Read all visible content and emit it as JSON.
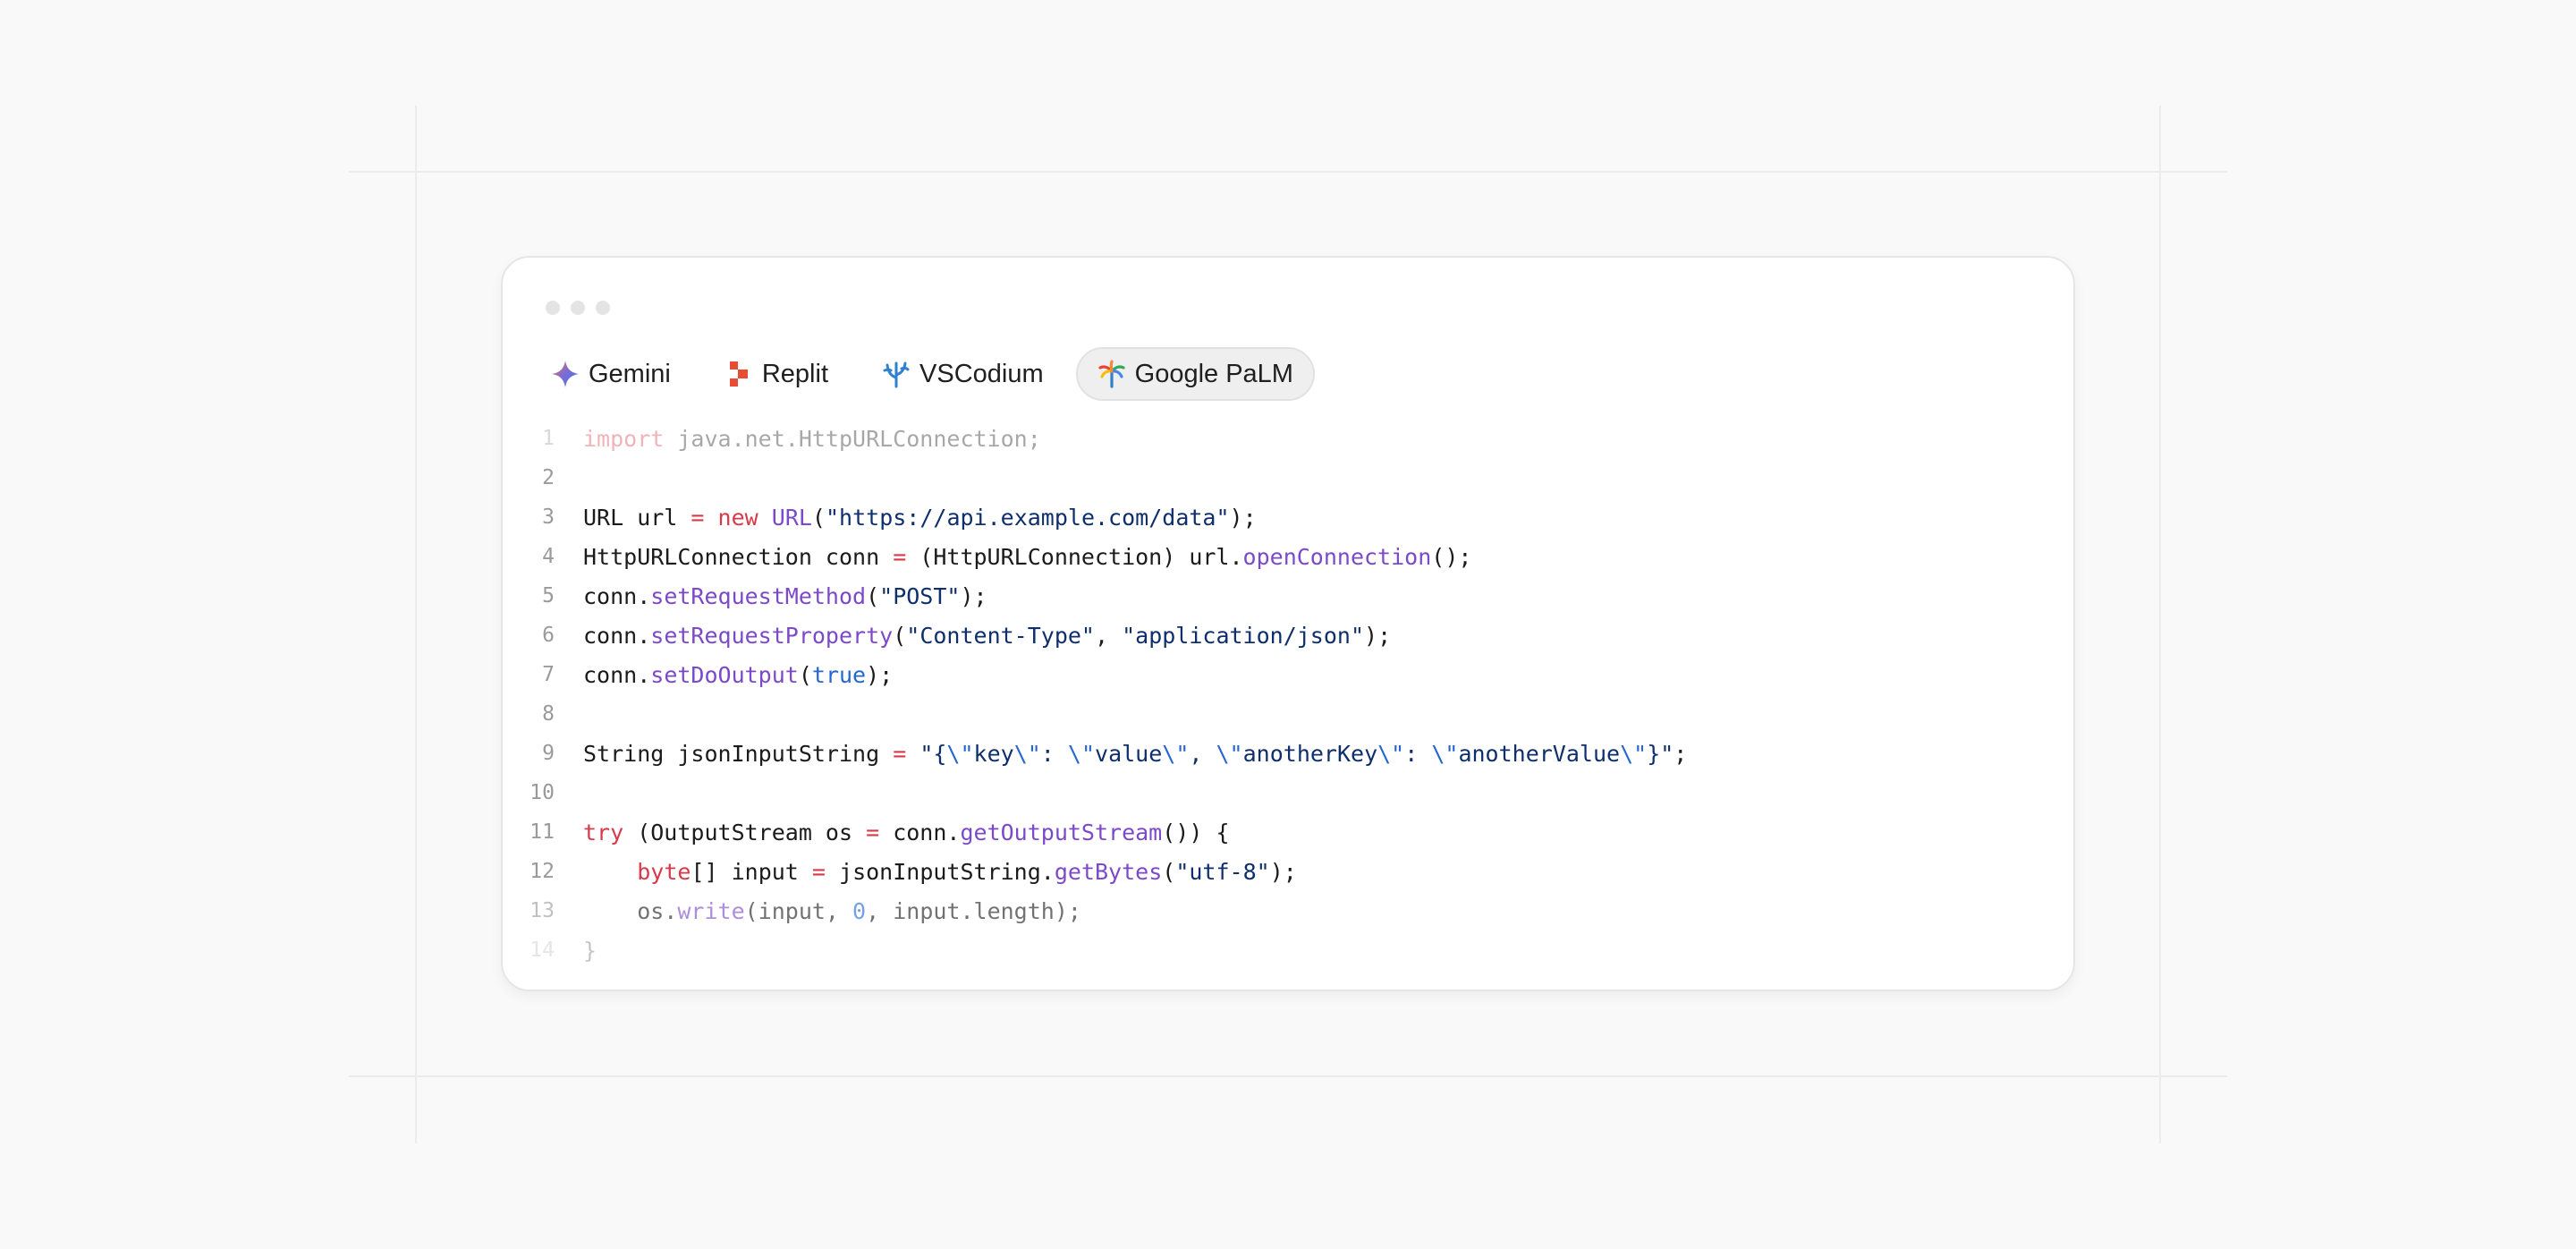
{
  "window": {
    "controls": [
      "close",
      "minimize",
      "maximize"
    ]
  },
  "tabs": [
    {
      "label": "Gemini",
      "icon": "gemini-icon",
      "active": false
    },
    {
      "label": "Replit",
      "icon": "replit-icon",
      "active": false
    },
    {
      "label": "VSCodium",
      "icon": "vscodium-icon",
      "active": false
    },
    {
      "label": "Google PaLM",
      "icon": "google-palm-icon",
      "active": true
    }
  ],
  "code": {
    "language": "java",
    "line_numbers": [
      "1",
      "2",
      "3",
      "4",
      "5",
      "6",
      "7",
      "8",
      "9",
      "10",
      "11",
      "12",
      "13",
      "14"
    ],
    "lines": [
      "import java.net.HttpURLConnection;",
      "",
      "URL url = new URL(\"https://api.example.com/data\");",
      "HttpURLConnection conn = (HttpURLConnection) url.openConnection();",
      "conn.setRequestMethod(\"POST\");",
      "conn.setRequestProperty(\"Content-Type\", \"application/json\");",
      "conn.setDoOutput(true);",
      "",
      "String jsonInputString = \"{\\\"key\\\": \\\"value\\\", \\\"anotherKey\\\": \\\"anotherValue\\\"}\";",
      "",
      "try (OutputStream os = conn.getOutputStream()) {",
      "    byte[] input = jsonInputString.getBytes(\"utf-8\");",
      "    os.write(input, 0, input.length);",
      "}"
    ]
  },
  "colors": {
    "keyword": "#d73a49",
    "function": "#7b49c9",
    "string": "#0e2f6b",
    "number": "#2467d1",
    "text": "#1b1b1b",
    "line_number": "#9a9a9a"
  }
}
